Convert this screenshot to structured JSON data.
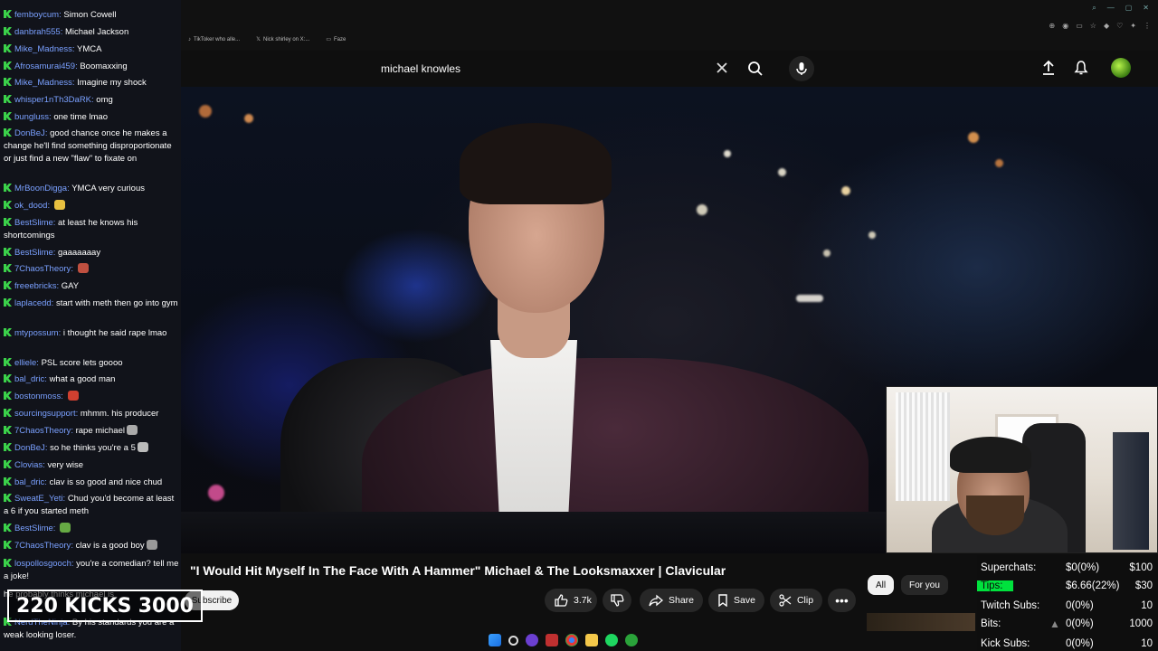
{
  "browser": {
    "bookmarks": [
      "TikToker who alle...",
      "Nick shirley on X:...",
      "Faze"
    ]
  },
  "youtube": {
    "search_query": "michael knowles",
    "video_title": "\"I Would Hit Myself In The Face With A Hammer\" Michael & The Looksmaxxer | Clavicular",
    "subscribe_label": "Subscribe",
    "likes": "3.7k",
    "share_label": "Share",
    "save_label": "Save",
    "clip_label": "Clip",
    "chips": [
      "All",
      "For you"
    ]
  },
  "chat": {
    "messages": [
      {
        "user": "femboycum",
        "text": "Simon Cowell"
      },
      {
        "user": "danbrah555",
        "text": "Michael Jackson"
      },
      {
        "user": "Mike_Madness",
        "text": "YMCA"
      },
      {
        "user": "Afrosamurai459",
        "text": "Boomaxxing"
      },
      {
        "user": "Mike_Madness",
        "text": "Imagine my shock"
      },
      {
        "user": "whisper1nTh3DaRK",
        "text": "omg"
      },
      {
        "user": "bungluss",
        "text": "one time lmao"
      },
      {
        "user": "DonBeJ",
        "text": "good chance once he makes a change he'll find something disproportionate or just find a new \"flaw\" to fixate on"
      },
      {
        "user": "MrBoonDigga",
        "text": "YMCA very curious"
      },
      {
        "user": "ok_dood",
        "text": ""
      },
      {
        "user": "BestSlime",
        "text": "at least he knows his shortcomings"
      },
      {
        "user": "BestSlime",
        "text": "gaaaaaaay"
      },
      {
        "user": "7ChaosTheory",
        "text": ""
      },
      {
        "user": "freeebricks",
        "text": "GAY"
      },
      {
        "user": "laplacedd",
        "text": "start with meth then go into gym"
      },
      {
        "user": "mtypossum",
        "text": "i thought he said rape lmao"
      },
      {
        "user": "elliele",
        "text": "PSL score lets goooo"
      },
      {
        "user": "bal_dric",
        "text": "what a good man"
      },
      {
        "user": "bostonmoss",
        "text": ""
      },
      {
        "user": "sourcingsupport",
        "text": "mhmm. his producer"
      },
      {
        "user": "7ChaosTheory",
        "text": "rape michael"
      },
      {
        "user": "DonBeJ",
        "text": "so he thinks you're a 5"
      },
      {
        "user": "Clovias",
        "text": "very wise"
      },
      {
        "user": "bal_dric",
        "text": "clav is so good and nice chud"
      },
      {
        "user": "SweatE_Yeti",
        "text": "Chud you'd become at least a 6 if you started meth"
      },
      {
        "user": "BestSlime",
        "text": ""
      },
      {
        "user": "7ChaosTheory",
        "text": "clav is a good boy"
      },
      {
        "user": "lospollosgooch",
        "text": "you're a comedian? tell me a joke!"
      },
      {
        "user": "",
        "text": "he probably thinks michael is"
      },
      {
        "user": "NerdTheNinja",
        "text": "By his standards you are a weak looking loser."
      }
    ]
  },
  "kicks": {
    "current": "220",
    "label": "KICKS",
    "goal": "3000"
  },
  "donations": {
    "rows": [
      {
        "label": "Superchats:",
        "value": "$0(0%)",
        "goal": "$100"
      },
      {
        "label": "Tips:",
        "value": "$6.66(22%)",
        "goal": "$30"
      },
      {
        "label": "Twitch Subs:",
        "value": "0(0%)",
        "goal": "10"
      },
      {
        "label": "Bits:",
        "value": "0(0%)",
        "goal": "1000"
      },
      {
        "label": "Kick Subs:",
        "value": "0(0%)",
        "goal": "10"
      }
    ],
    "accent": "#00e23d"
  }
}
